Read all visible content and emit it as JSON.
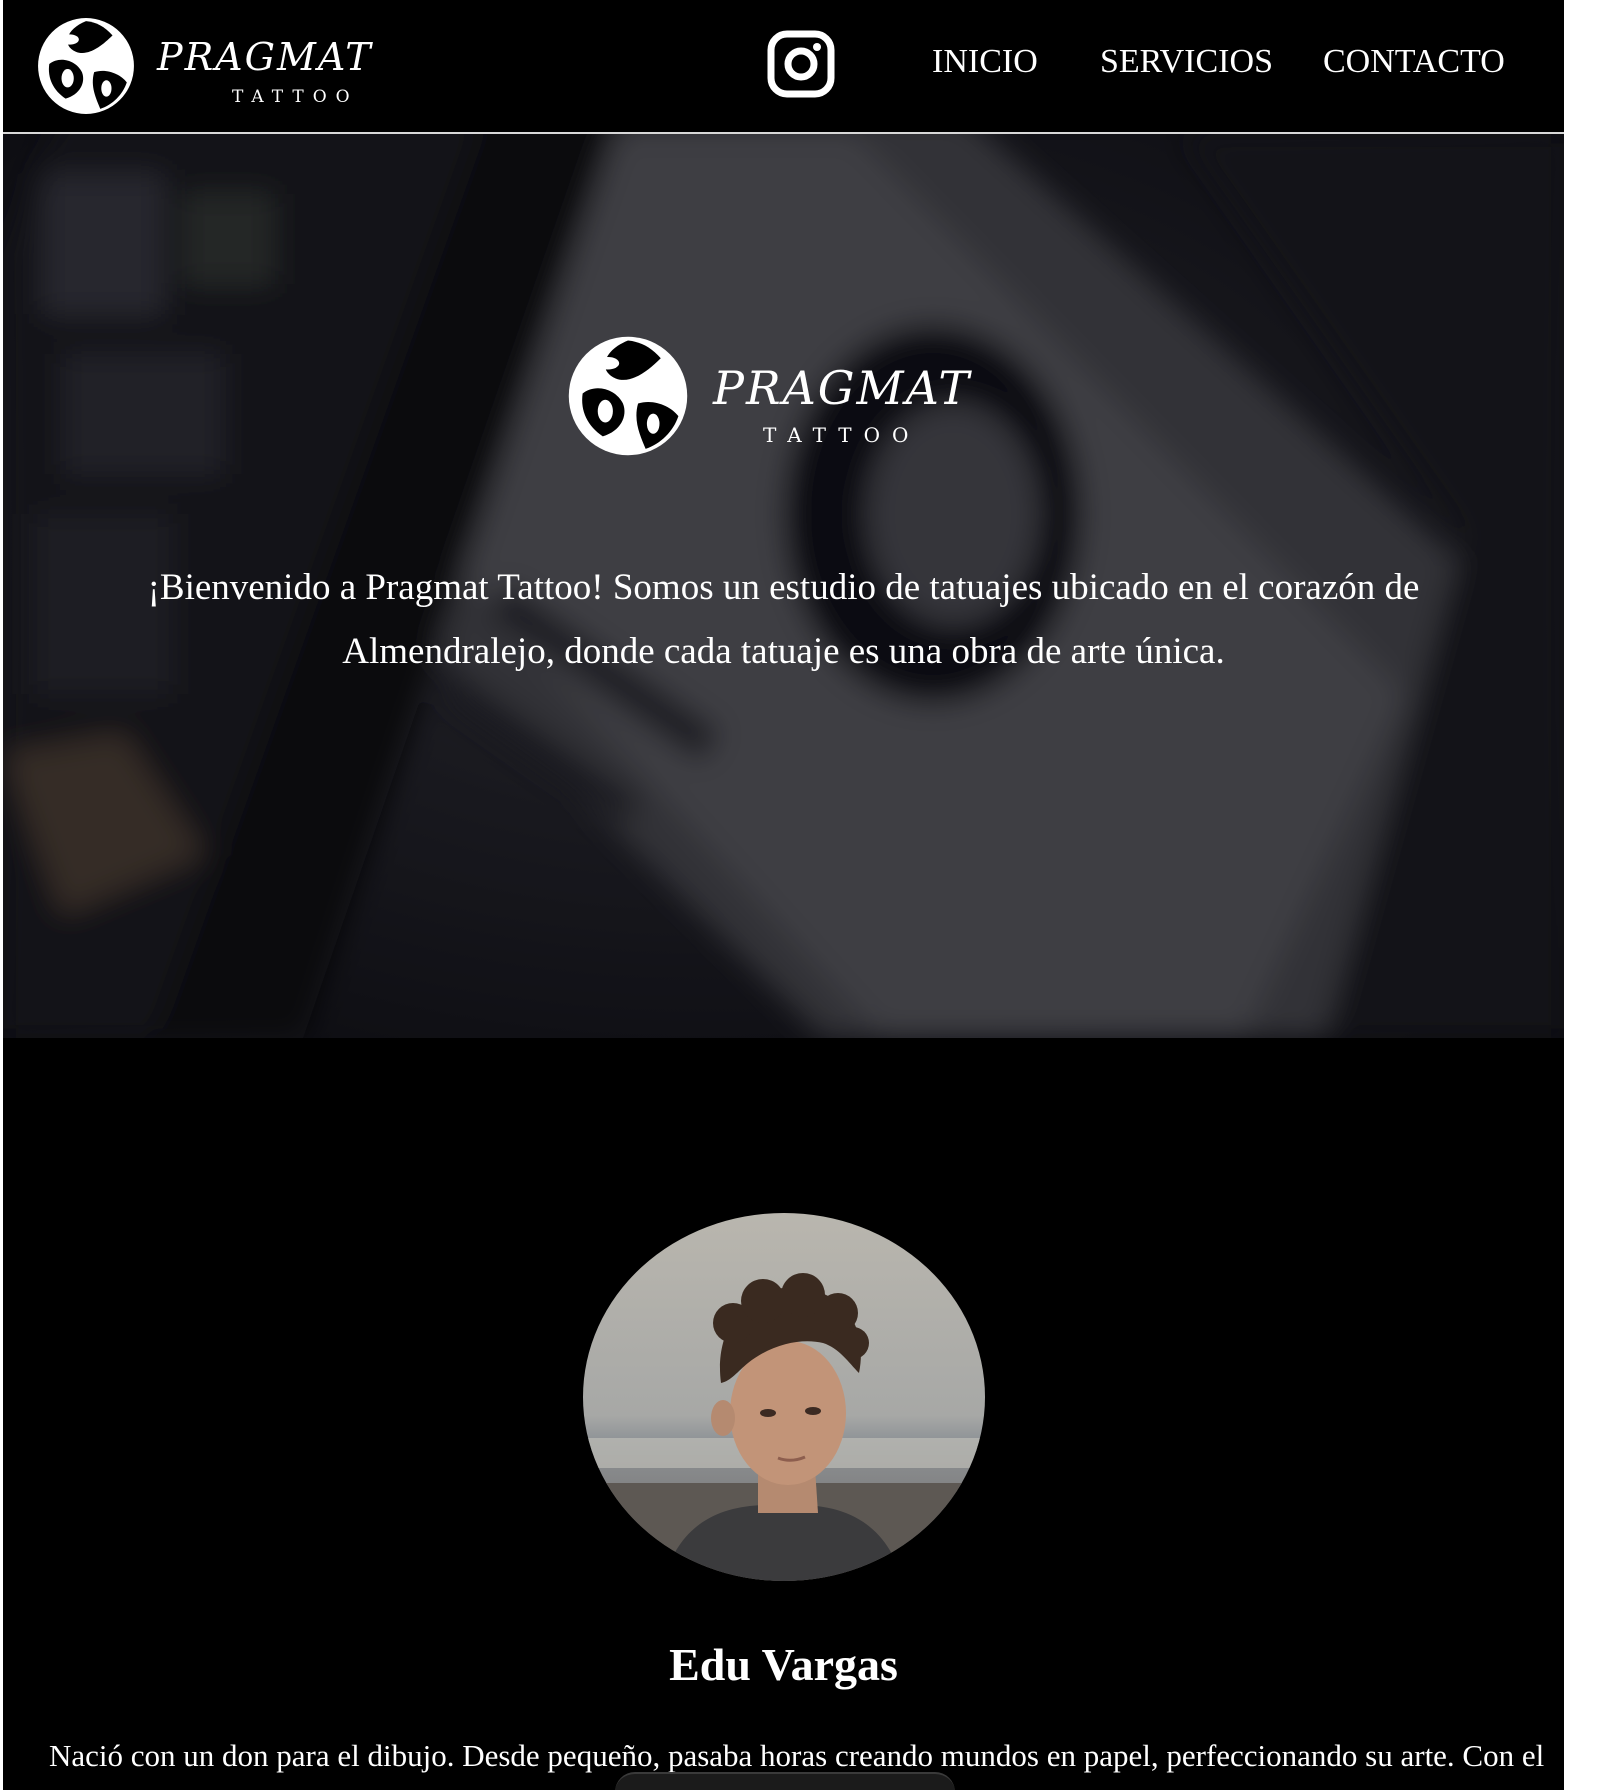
{
  "brand": {
    "name": "PRAGMAT",
    "tagline": "TATTOO"
  },
  "nav": {
    "instagram_icon": "instagram-icon",
    "links": [
      {
        "label": "INICIO"
      },
      {
        "label": "SERVICIOS"
      },
      {
        "label": "CONTACTO"
      }
    ]
  },
  "hero": {
    "welcome_line1": "¡Bienvenido a Pragmat Tattoo! Somos un estudio de tatuajes ubicado en el corazón de",
    "welcome_line2": "Almendralejo, donde cada tatuaje es una obra de arte única."
  },
  "artist": {
    "name": "Edu Vargas",
    "bio": "Nació con un don para el dibujo. Desde pequeño, pasaba horas creando mundos en papel, perfeccionando su arte. Con el"
  },
  "colors": {
    "background": "#000000",
    "text": "#ffffff",
    "nav_border": "#d8d8d8"
  }
}
